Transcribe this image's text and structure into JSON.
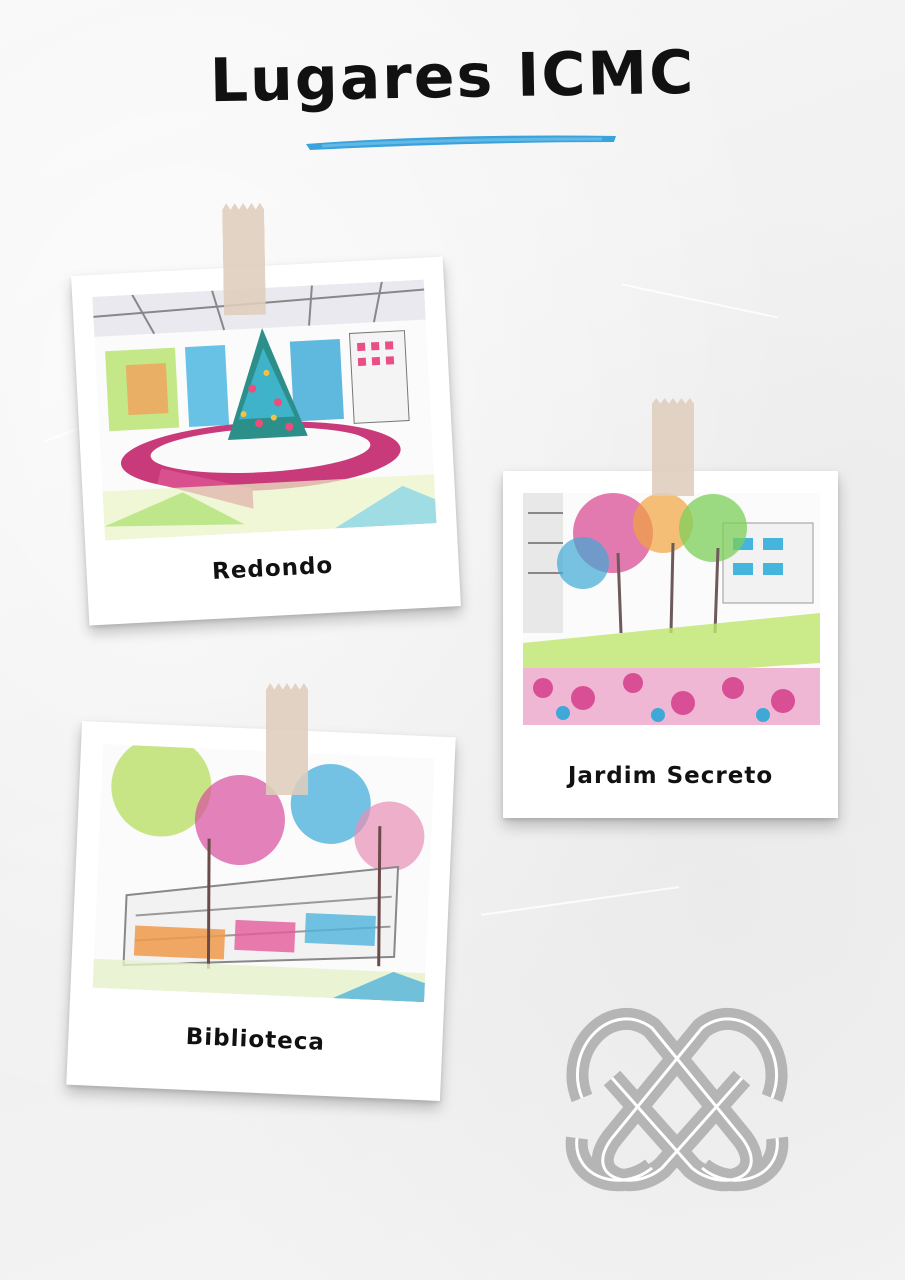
{
  "title": "Lugares ICMC",
  "colors": {
    "accent_underline": "#3ba3dc",
    "tape": "#decdbc",
    "logo": "#b5b5b5",
    "background": "#f3f3f3"
  },
  "polaroids": [
    {
      "caption": "Redondo"
    },
    {
      "caption": "Jardim Secreto"
    },
    {
      "caption": "Biblioteca"
    }
  ],
  "logo_icon": "knot-logo-icon"
}
